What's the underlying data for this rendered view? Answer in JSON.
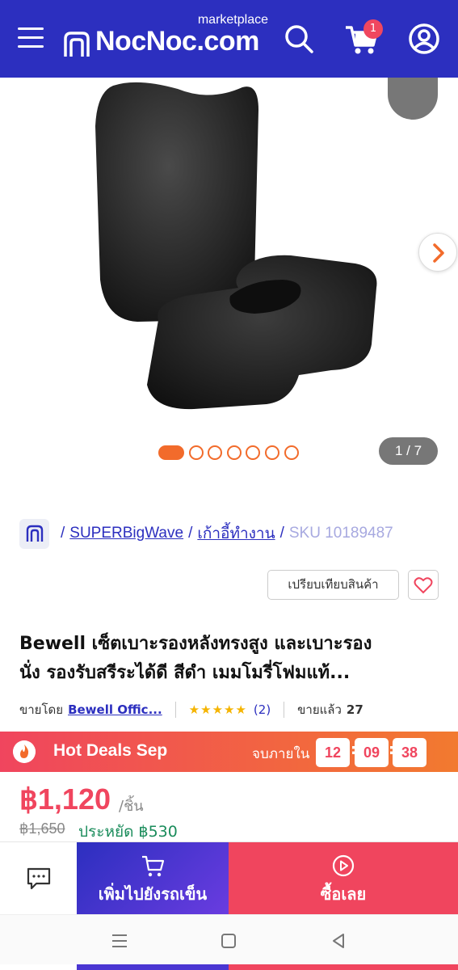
{
  "header": {
    "brand_sub": "marketplace",
    "brand_name": "NocNoc.com",
    "cart_count": "1",
    "icons": [
      "hamburger-icon",
      "search-icon",
      "cart-icon",
      "user-icon"
    ]
  },
  "gallery": {
    "counter": "1 / 7",
    "current_index": 1,
    "total_images": 7
  },
  "breadcrumb": {
    "items": [
      "SUPERBigWave",
      "เก้าอี้ทำงาน"
    ],
    "separator": "/",
    "sku": "SKU 10189487"
  },
  "compare_label": "เปรียบเทียบสินค้า",
  "product": {
    "title_line1": "Bewell เซ็ตเบาะรองหลังทรงสูง และเบาะรอง",
    "title_line2": "นั่ง รองรับสรีระได้ดี สีดำ เมมโมรี่โฟมแท้...",
    "sold_by_label": "ขายโดย",
    "seller": "Bewell Offic...",
    "rating_stars": "★★★★★",
    "rating_value": 5,
    "reviews": "(2)",
    "sold_label": "ขายแล้ว",
    "sold_count": "27"
  },
  "deal": {
    "title": "Hot Deals Sep",
    "ends_label": "จบภายใน",
    "hours": "12",
    "minutes": "09",
    "seconds": "38"
  },
  "price": {
    "current": "฿1,120",
    "unit": "/ชิ้น",
    "original": "฿1,650",
    "savings": "ประหยัด ฿530"
  },
  "actions": {
    "add_to_cart": "เพิ่มไปยังรถเข็น",
    "buy_now": "ซื้อเลย"
  },
  "colors": {
    "brand_blue": "#2c2fbf",
    "accent_orange": "#f26b2b",
    "price_red": "#f0455e",
    "save_green": "#1a8c5b"
  }
}
